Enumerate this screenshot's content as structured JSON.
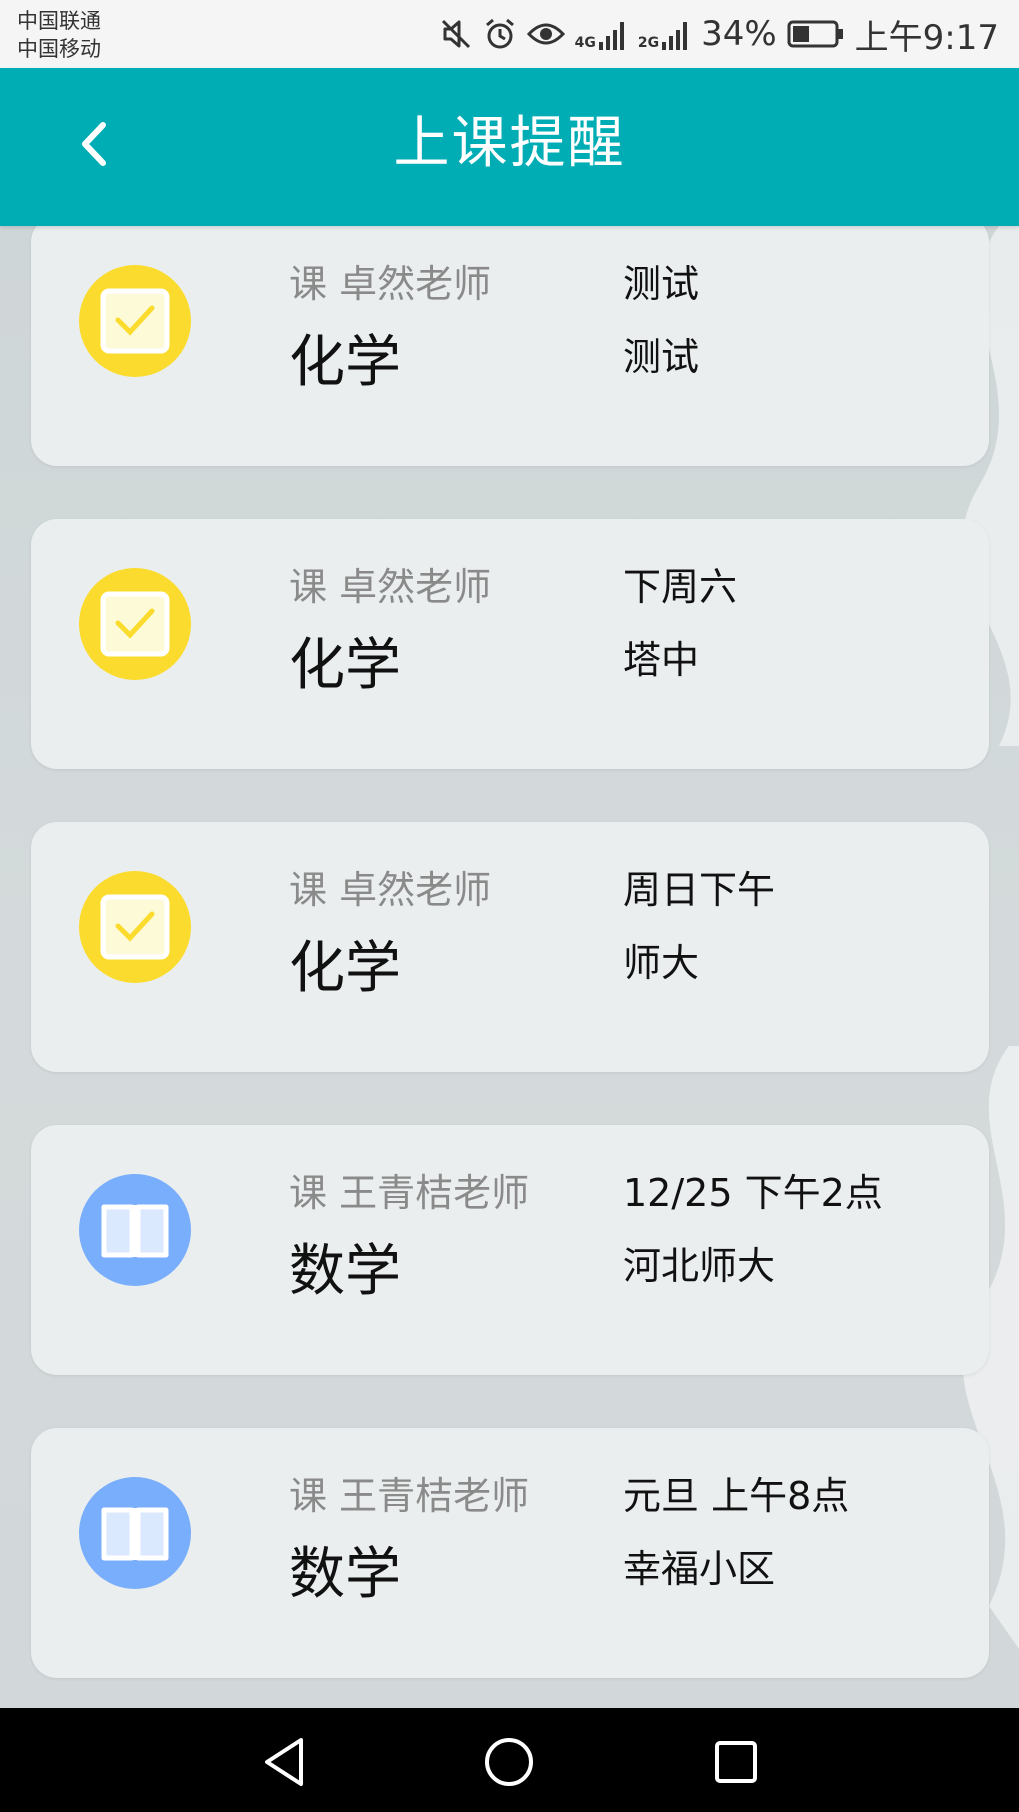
{
  "status_bar": {
    "carrier_1": "中国联通",
    "carrier_2": "中国移动",
    "network_1": "4G",
    "network_2": "2G",
    "battery": "34%",
    "time": "上午9:17",
    "icons": [
      "mute-icon",
      "alarm-icon",
      "eye-icon",
      "signal-icon",
      "signal-icon",
      "battery-icon"
    ]
  },
  "header": {
    "title": "上课提醒",
    "back_icon": "chevron-left-icon"
  },
  "reminders": [
    {
      "icon": "check-icon",
      "icon_color": "#fbdc2e",
      "teacher": "课 卓然老师",
      "subject": "化学",
      "time": "测试",
      "place": "测试"
    },
    {
      "icon": "check-icon",
      "icon_color": "#fbdc2e",
      "teacher": "课 卓然老师",
      "subject": "化学",
      "time": "下周六",
      "place": "塔中"
    },
    {
      "icon": "check-icon",
      "icon_color": "#fbdc2e",
      "teacher": "课 卓然老师",
      "subject": "化学",
      "time": "周日下午",
      "place": "师大"
    },
    {
      "icon": "book-icon",
      "icon_color": "#78aefc",
      "teacher": "课 王青桔老师",
      "subject": "数学",
      "time": "12/25 下午2点",
      "place": "河北师大"
    },
    {
      "icon": "book-icon",
      "icon_color": "#78aefc",
      "teacher": "课 王青桔老师",
      "subject": "数学",
      "time": "元旦 上午8点",
      "place": "幸福小区"
    }
  ],
  "colors": {
    "header": "#00adb5",
    "card": "#eaeeef",
    "background": "#d2d8d9"
  },
  "nav_bar": {
    "icons": [
      "back-triangle-icon",
      "home-circle-icon",
      "recent-square-icon"
    ]
  }
}
